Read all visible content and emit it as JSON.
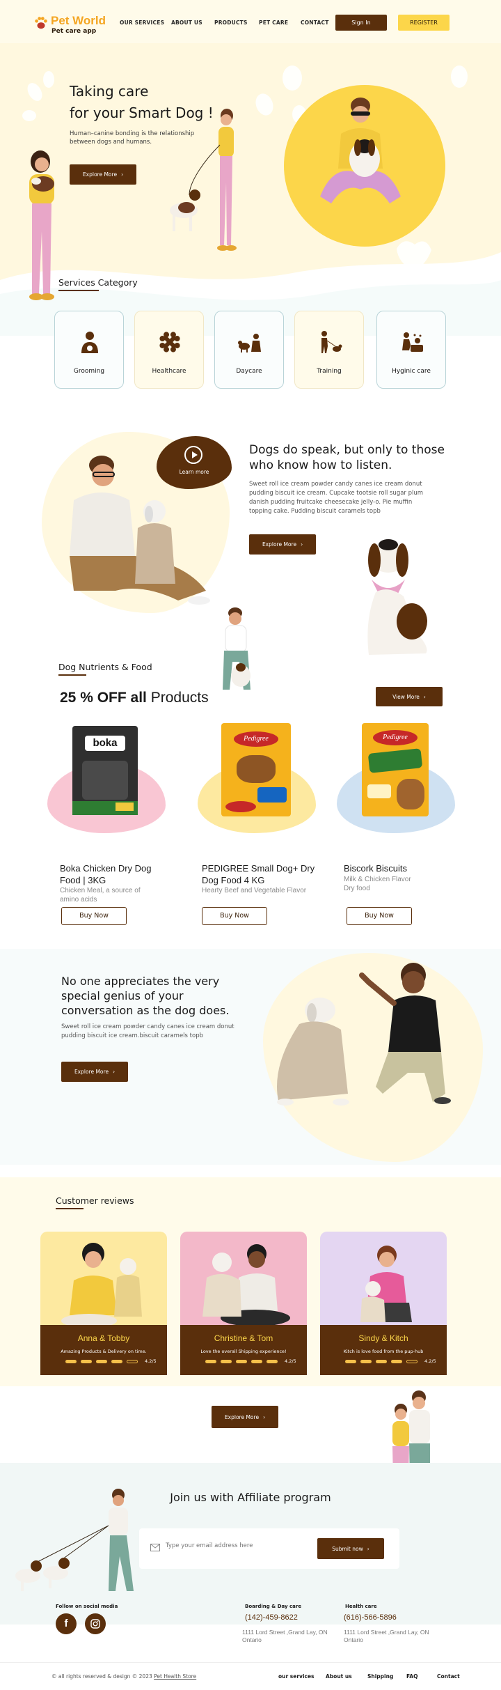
{
  "brand": {
    "title": "Pet World",
    "subtitle": "Pet care app",
    "icon": "paw-icon"
  },
  "nav": {
    "links": [
      "OUR SERVICES",
      "ABOUT US",
      "PRODUCTS",
      "PET CARE",
      "CONTACT"
    ],
    "signin_label": "Sign In",
    "register_label": "REGISTER"
  },
  "hero": {
    "title_line1": "Taking care",
    "title_line2": "for your Smart Dog !",
    "text": "Human–canine bonding is the relationship between dogs and humans.",
    "cta_label": "Explore More"
  },
  "services": {
    "title": "Services Category",
    "items": [
      {
        "label": "Grooming",
        "icon": "grooming-icon"
      },
      {
        "label": "Healthcare",
        "icon": "bone-icon"
      },
      {
        "label": "Daycare",
        "icon": "daycare-icon"
      },
      {
        "label": "Training",
        "icon": "training-icon"
      },
      {
        "label": "Hyginic care",
        "icon": "bath-icon"
      }
    ]
  },
  "talk": {
    "learn_label": "Learn more",
    "title": "Dogs do speak, but only to those who know how to listen.",
    "text": "Sweet roll ice cream powder candy canes ice cream donut pudding biscuit ice cream. Cupcake tootsie roll sugar plum danish pudding fruitcake cheesecake jelly-o. Pie muffin topping cake. Pudding biscuit caramels topb",
    "cta_label": "Explore More"
  },
  "nutrients": {
    "title": "Dog Nutrients & Food",
    "offer_bold": "25 % OFF all",
    "offer_rest": " Products",
    "view_label": "View More",
    "buy_label": "Buy Now",
    "products": [
      {
        "brand": "boka",
        "name": "Boka Chicken Dry Dog Food | 3KG",
        "sub": "Chicken Meal, a source of amino acids",
        "blob": "#f9c6d3"
      },
      {
        "brand": "Pedigree",
        "name": "PEDIGREE Small Dog+ Dry Dog Food 4 KG",
        "sub": "Hearty Beef and Vegetable Flavor",
        "blob": "#fde9a0"
      },
      {
        "brand": "Pedigree",
        "name": "Biscork Biscuits",
        "sub": "Milk & Chicken Flavor Dry food",
        "blob": "#cfe1f2"
      }
    ]
  },
  "genius": {
    "title": "No one appreciates the very special genius of your conversation as the dog does.",
    "text": "Sweet roll ice cream powder candy canes ice cream donut pudding biscuit ice cream.biscuit caramels topb",
    "cta_label": "Explore More"
  },
  "reviews": {
    "title": "Customer reviews",
    "items": [
      {
        "name": "Anna & Tobby",
        "text": "Amazing Products & Delivery on time.",
        "rating": "4.2/5",
        "score": 4,
        "bg": "#fde9a0"
      },
      {
        "name": "Christine & Tom",
        "text": "Love the overall Shipping experience!",
        "rating": "4.2/5",
        "score": 5,
        "bg": "#f3b8c9"
      },
      {
        "name": "Sindy & Kitch",
        "text": "Kitch is love food from the pup-hub",
        "rating": "4.2/5",
        "score": 4,
        "bg": "#e4d6f2"
      }
    ],
    "explore_label": "Explore More"
  },
  "affiliate": {
    "title": "Join us with Affiliate program",
    "email_placeholder": "Type your email address here",
    "submit_label": "Submit now"
  },
  "footer": {
    "social_label": "Follow on social media",
    "boarding": {
      "label": "Boarding & Day care",
      "phone": "(142)-459-8622",
      "address": "1111  Lord Street ,Grand Lay, ON  Ontario"
    },
    "health": {
      "label": "Health care",
      "phone": "(616)-566-5896",
      "address": "1111  Lord Street ,Grand Lay, ON  Ontario"
    },
    "copyright": "© all rights reserved & design © 2023",
    "store_link": "Pet Health Store",
    "links": [
      "our services",
      "About us",
      "Shipping",
      "FAQ",
      "Contact"
    ]
  },
  "colors": {
    "brown": "#5a2f0c",
    "yellow": "#fcd64a",
    "orange": "#f4a521",
    "cream": "#fff8df"
  }
}
